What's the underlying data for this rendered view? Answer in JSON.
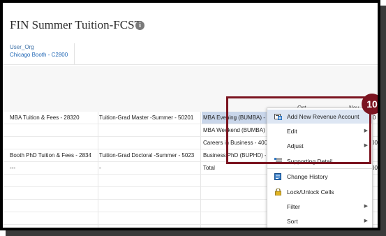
{
  "page": {
    "title": "FIN Summer Tuition-FCST"
  },
  "pov": {
    "label": "User_Org",
    "value": "Chicago Booth - C2800"
  },
  "grid": {
    "col_headers": [
      "Oct",
      "Nov"
    ],
    "rows": [
      {
        "c1": "MBA Tuition & Fees - 28320",
        "c2": "Tuition-Grad Master -Summer - 50201",
        "c3": "MBA Evening (BUMBA) -",
        "c4": "0"
      },
      {
        "c1": "",
        "c2": "",
        "c3": "MBA Weekend (BUMBA)",
        "c4": ""
      },
      {
        "c1": "",
        "c2": "",
        "c3": "Careers in Business - 400",
        "c4": "00"
      },
      {
        "c1": "Booth PhD Tuition & Fees - 2834",
        "c2": "Tuition-Grad Doctoral -Summer - 5023",
        "c3": "Business PhD (BUPHD) -",
        "c4": ""
      },
      {
        "c1": "---",
        "c2": "-",
        "c3": "Total",
        "c4": "00"
      }
    ]
  },
  "context_menu": {
    "items": [
      {
        "label": "Add New Revenue Account",
        "icon": "add-account-icon",
        "submenu": false
      },
      {
        "label": "Edit",
        "icon": "",
        "submenu": true
      },
      {
        "label": "Adjust",
        "icon": "",
        "submenu": true
      },
      {
        "label": "Supporting Detail",
        "icon": "supporting-detail-icon",
        "submenu": false
      },
      {
        "label": "Change History",
        "icon": "change-history-icon",
        "submenu": false
      },
      {
        "label": "Lock/Unlock Cells",
        "icon": "lock-icon",
        "submenu": false
      },
      {
        "label": "Filter",
        "icon": "",
        "submenu": true
      },
      {
        "label": "Sort",
        "icon": "",
        "submenu": true
      }
    ]
  },
  "callout": {
    "number": "10",
    "color": "#7b1420"
  }
}
